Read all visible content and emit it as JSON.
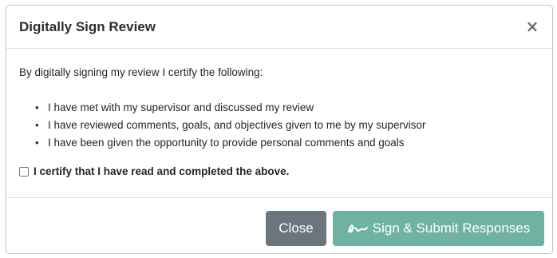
{
  "modal": {
    "title": "Digitally Sign Review",
    "close_glyph": "×",
    "intro": "By digitally signing my review I certify the following:",
    "bullet_glyph": "•",
    "items": [
      "I have met with my supervisor and discussed my review",
      "I have reviewed comments, goals, and objectives given to me by my supervisor",
      "I have been given the opportunity to provide personal comments and goals"
    ],
    "certify_label": "I certify that I have read and completed the above.",
    "certify_checked": false
  },
  "footer": {
    "close_label": "Close",
    "submit_label": "Sign & Submit Responses",
    "submit_icon": "signature-icon"
  },
  "colors": {
    "close_button": "#6c757d",
    "submit_button": "#6fb1a3"
  }
}
